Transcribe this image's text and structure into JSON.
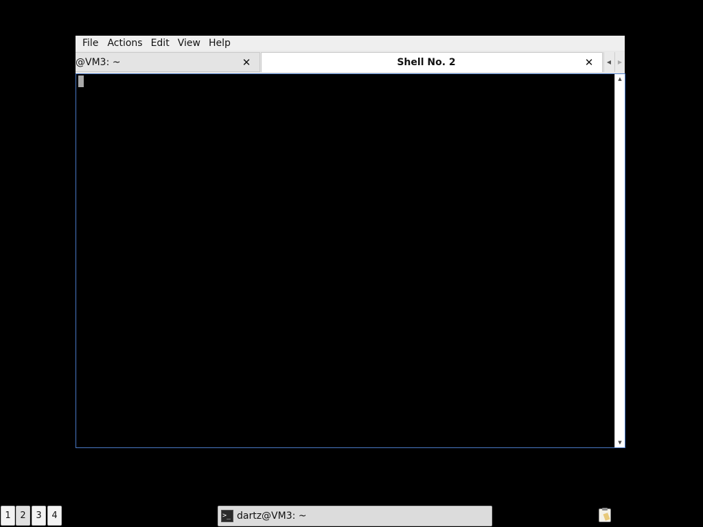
{
  "menubar": {
    "items": [
      "File",
      "Actions",
      "Edit",
      "View",
      "Help"
    ]
  },
  "tabs": [
    {
      "label": "@VM3: ~",
      "active": false
    },
    {
      "label": "Shell No. 2",
      "active": true
    }
  ],
  "icons": {
    "tab_close": "close-icon",
    "tab_scroll_left": "chevron-left-icon",
    "tab_scroll_right": "chevron-right-icon",
    "scroll_up": "arrow-up-icon",
    "scroll_down": "arrow-down-icon",
    "terminal": "terminal-icon",
    "clipboard": "clipboard-icon"
  },
  "glyphs": {
    "close": "✕",
    "left": "◀",
    "right": "▶",
    "up": "▲",
    "down": "▼",
    "prompt": ">_"
  },
  "taskbar": {
    "desktops": [
      "1",
      "2",
      "3",
      "4"
    ],
    "active_desktop": "2",
    "task_label": "dartz@VM3: ~"
  },
  "colors": {
    "terminal_background": "#000000",
    "focus_border": "#4a7bc8",
    "cursor": "#a9a9a9"
  }
}
